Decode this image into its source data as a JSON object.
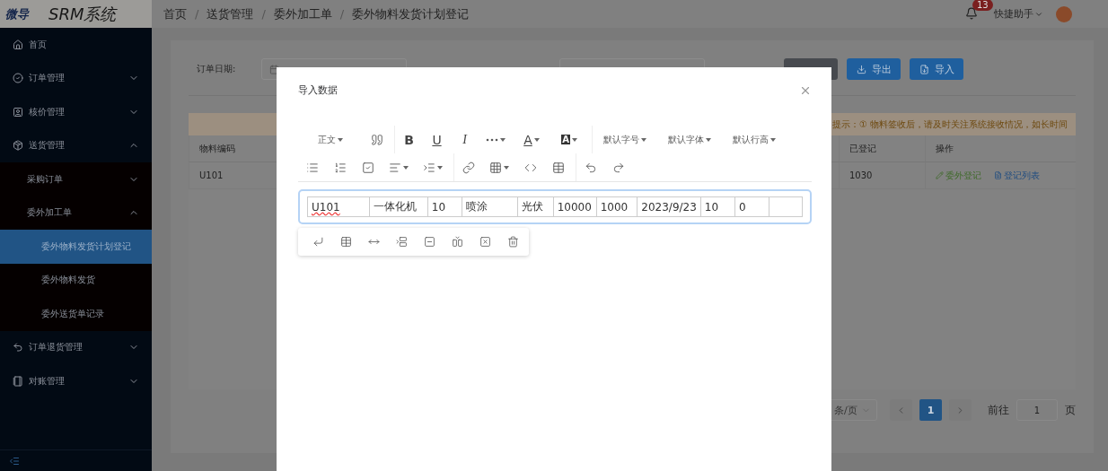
{
  "header": {
    "logo": "微导",
    "system_name": "SRM系统",
    "breadcrumb": [
      "首页",
      "送货管理",
      "委外加工单",
      "委外物料发货计划登记"
    ],
    "breadcrumb_separators": [
      "/",
      "/",
      "/"
    ],
    "notification_count": "13",
    "user_menu": "快捷助手"
  },
  "sidebar": {
    "items": [
      {
        "label": "首页",
        "selected": false
      },
      {
        "label": "订单管理",
        "selected": false,
        "expanded": false
      },
      {
        "label": "核价管理",
        "selected": false,
        "expanded": false
      },
      {
        "label": "送货管理",
        "selected": false,
        "expanded": true,
        "children": [
          {
            "label": "采购订单",
            "selected": false,
            "expanded": false
          },
          {
            "label": "委外加工单",
            "selected": false,
            "expanded": true,
            "children": [
              {
                "label": "委外物料发货计划登记",
                "selected": true
              },
              {
                "label": "委外物料发货",
                "selected": false
              },
              {
                "label": "委外送货单记录",
                "selected": false
              }
            ]
          }
        ]
      },
      {
        "label": "订单退货管理",
        "selected": false,
        "expanded": false
      },
      {
        "label": "对账管理",
        "selected": false,
        "expanded": false
      }
    ]
  },
  "filters": {
    "date_label": "订单日期:",
    "buttons": [
      {
        "kind": "search"
      },
      {
        "kind": "export",
        "label": "导出"
      },
      {
        "kind": "import",
        "label": "导入"
      }
    ]
  },
  "alert": "提示：① 物料签收后，请及时关注系统接收情况，如长时间",
  "table": {
    "columns": [
      "物料编码",
      "已登记",
      "操作"
    ],
    "rows": [
      {
        "cells": [
          "U101",
          "1030"
        ],
        "actions": [
          {
            "kind": "edit",
            "label": "委外登记"
          },
          {
            "kind": "list",
            "label": "登记列表"
          }
        ]
      }
    ]
  },
  "pagination": {
    "page_size": "条/页",
    "pages": [
      {
        "label": "1",
        "selected": true
      }
    ],
    "goto_label": "前往",
    "goto_value": "1",
    "page_suffix": "页"
  },
  "dialog": {
    "title": "导入数据",
    "toolbar_rows": [
      [
        [
          {
            "kind": "select",
            "label": "正文"
          },
          {
            "kind": "icon",
            "caret": false
          }
        ],
        [
          {
            "kind": "bold",
            "label": "B"
          },
          {
            "kind": "underline",
            "label": "U"
          },
          {
            "kind": "italic",
            "label": "I"
          },
          {
            "kind": "icon",
            "caret": true
          },
          {
            "kind": "font-color",
            "label": "A"
          },
          {
            "kind": "back-color",
            "label": "A"
          }
        ],
        [
          {
            "kind": "select",
            "label": "默认字号"
          },
          {
            "kind": "select",
            "label": "默认字体"
          },
          {
            "kind": "select",
            "label": "默认行高"
          }
        ]
      ],
      [
        [
          {
            "kind": "icon",
            "caret": false
          },
          {
            "kind": "icon",
            "caret": false
          },
          {
            "kind": "icon",
            "caret": false
          },
          {
            "kind": "icon",
            "caret": true
          },
          {
            "kind": "icon",
            "caret": true
          }
        ],
        [
          {
            "kind": "icon",
            "caret": false
          },
          {
            "kind": "icon",
            "caret": true
          },
          {
            "kind": "icon",
            "caret": false
          },
          {
            "kind": "icon",
            "caret": false
          }
        ],
        [
          {
            "kind": "icon",
            "caret": false
          },
          {
            "kind": "icon",
            "caret": false
          }
        ]
      ]
    ],
    "table_cells": [
      {
        "text": "U101",
        "misspelled": true
      },
      {
        "text": "一体化机",
        "misspelled": false
      },
      {
        "text": "10",
        "misspelled": false
      },
      {
        "text": "喷涂",
        "misspelled": false
      },
      {
        "text": "光伏",
        "misspelled": false
      },
      {
        "text": "10000",
        "misspelled": false
      },
      {
        "text": "1000",
        "misspelled": false
      },
      {
        "text": "2023/9/23",
        "misspelled": false
      },
      {
        "text": "10",
        "misspelled": false
      },
      {
        "text": "0",
        "misspelled": false
      }
    ]
  }
}
